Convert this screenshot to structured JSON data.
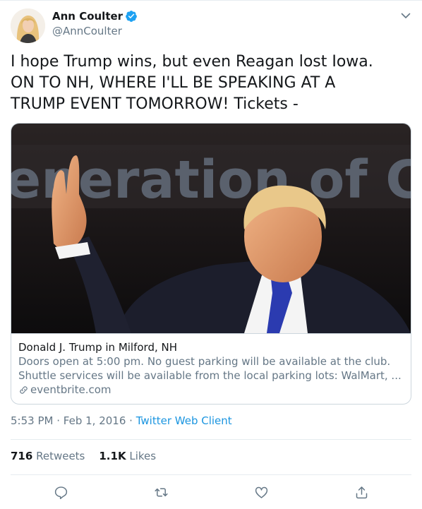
{
  "author": {
    "display_name": "Ann Coulter",
    "handle": "@AnnCoulter",
    "verified": true
  },
  "tweet": {
    "text": "I hope Trump wins, but even Reagan lost Iowa.\nON TO NH, WHERE I'LL BE SPEAKING AT A\nTRUMP EVENT TOMORROW! Tickets -"
  },
  "card": {
    "banner_text": "eneration of Conse",
    "title": "Donald J. Trump in Milford, NH",
    "description_line1": "Doors open at 5:00 pm. No guest parking will be available at the club.",
    "description_line2": "Shuttle services will be available from the local parking lots: WalMart, ...",
    "domain": "eventbrite.com"
  },
  "meta": {
    "time": "5:53 PM",
    "separator": "·",
    "date": "Feb 1, 2016",
    "client": "Twitter Web Client"
  },
  "stats": {
    "retweets_count": "716",
    "retweets_label": "Retweets",
    "likes_count": "1.1K",
    "likes_label": "Likes"
  },
  "icons": {
    "verified": "verified-badge-icon",
    "caret": "chevron-down-icon",
    "link": "link-icon",
    "reply": "reply-icon",
    "retweet": "retweet-icon",
    "like": "heart-icon",
    "share": "share-icon"
  },
  "colors": {
    "text": "#14171a",
    "secondary": "#657786",
    "link": "#1b95e0",
    "border": "#ccd6dd",
    "verified": "#1da1f2"
  }
}
